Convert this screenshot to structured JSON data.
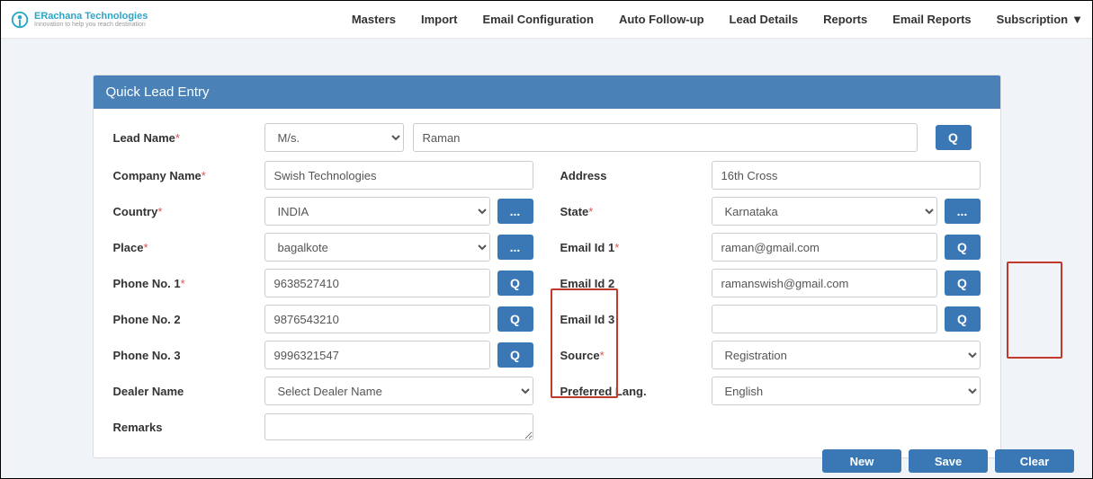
{
  "logo": {
    "title": "ERachana Technologies",
    "tagline": "Innovation to help you reach destination"
  },
  "nav": {
    "masters": "Masters",
    "import": "Import",
    "email_config": "Email Configuration",
    "auto_followup": "Auto Follow-up",
    "lead_details": "Lead Details",
    "reports": "Reports",
    "email_reports": "Email Reports",
    "subscription": "Subscription"
  },
  "panel_title": "Quick Lead Entry",
  "labels": {
    "lead_name": "Lead Name",
    "company_name": "Company Name",
    "country": "Country",
    "place": "Place",
    "phone1": "Phone No. 1",
    "phone2": "Phone No. 2",
    "phone3": "Phone No. 3",
    "dealer": "Dealer Name",
    "remarks": "Remarks",
    "address": "Address",
    "state": "State",
    "email1": "Email Id 1",
    "email2": "Email Id 2",
    "email3": "Email Id 3",
    "source": "Source",
    "lang": "Preferred Lang."
  },
  "values": {
    "title_select": "M/s.",
    "lead_name": "Raman",
    "company_name": "Swish Technologies",
    "country": "INDIA",
    "place": "bagalkote",
    "phone1": "9638527410",
    "phone2": "9876543210",
    "phone3": "9996321547",
    "dealer": "Select Dealer Name",
    "remarks": "",
    "address": "16th Cross",
    "state": "Karnataka",
    "email1": "raman@gmail.com",
    "email2": "ramanswish@gmail.com",
    "email3": "",
    "source": "Registration",
    "lang": "English"
  },
  "buttons": {
    "q": "Q",
    "dots": "...",
    "new": "New",
    "save": "Save",
    "clear": "Clear"
  }
}
